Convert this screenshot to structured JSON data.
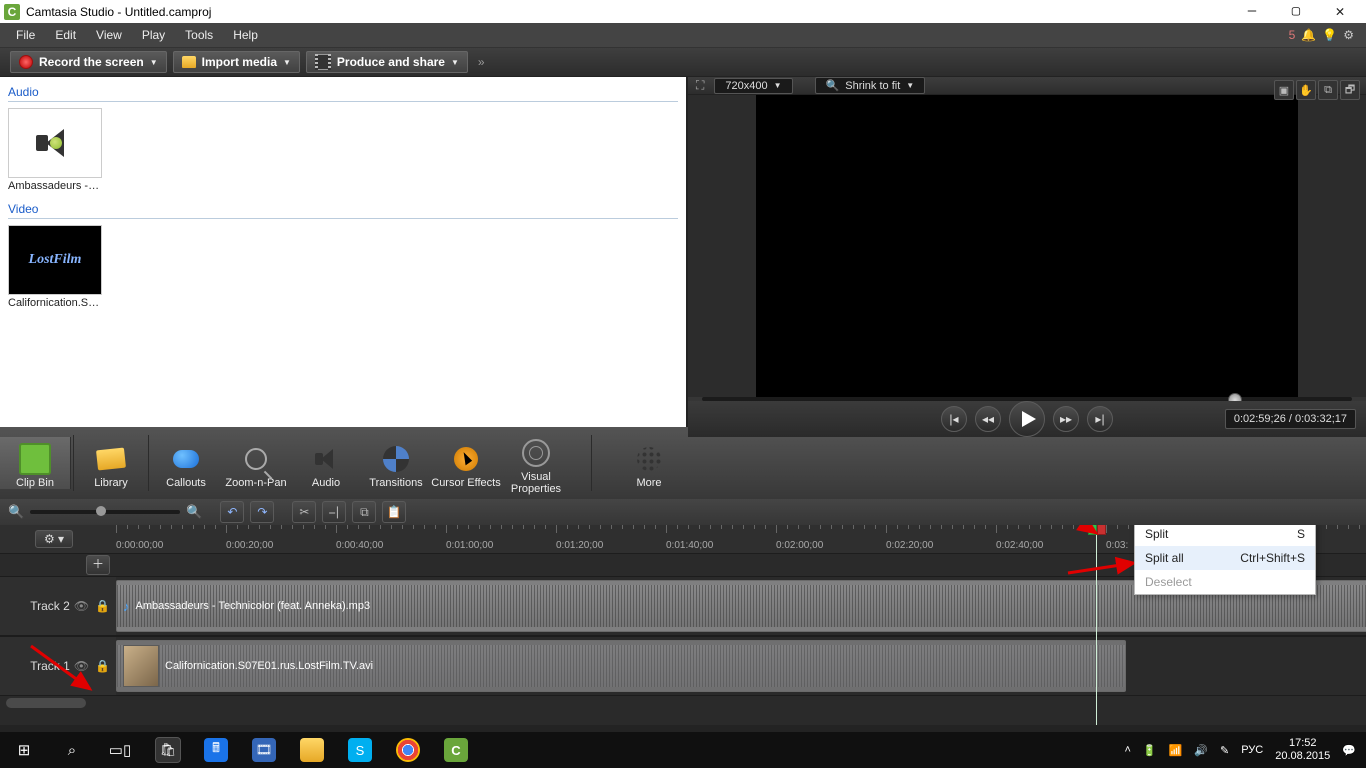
{
  "window": {
    "title": "Camtasia Studio - Untitled.camproj",
    "app": "C"
  },
  "menu": {
    "items": [
      "File",
      "Edit",
      "View",
      "Play",
      "Tools",
      "Help"
    ],
    "alert_count": "5"
  },
  "toolbar": {
    "record": "Record the screen",
    "import": "Import media",
    "produce": "Produce and share"
  },
  "clipbin": {
    "audio_label": "Audio",
    "audio": {
      "name": "Ambassadeurs - Technicolor (fe..."
    },
    "video_label": "Video",
    "video": {
      "name": "Californication.S0...",
      "thumb_text": "LostFilm"
    }
  },
  "preview": {
    "dim": "720x400",
    "shrink": "Shrink to fit",
    "time": "0:02:59;26 / 0:03:32;17"
  },
  "tabs": {
    "items": [
      "Clip Bin",
      "Library",
      "Callouts",
      "Zoom-n-Pan",
      "Audio",
      "Transitions",
      "Cursor Effects",
      "Visual Properties",
      "More"
    ]
  },
  "timeline": {
    "ticks": [
      "0:00:00;00",
      "0:00:20;00",
      "0:00:40;00",
      "0:01:00;00",
      "0:01:20;00",
      "0:01:40;00",
      "0:02:00;00",
      "0:02:20;00",
      "0:02:40;00",
      "0:03:"
    ],
    "track2": {
      "name": "Track 2",
      "clip": "Ambassadeurs - Technicolor (feat. Anneka).mp3"
    },
    "track1": {
      "name": "Track 1",
      "clip": "Californication.S07E01.rus.LostFilm.TV.avi"
    }
  },
  "context": {
    "split": {
      "label": "Split",
      "key": "S"
    },
    "splitall": {
      "label": "Split all",
      "key": "Ctrl+Shift+S"
    },
    "deselect": {
      "label": "Deselect"
    }
  },
  "taskbar": {
    "lang": "РУС",
    "time": "17:52",
    "date": "20.08.2015"
  }
}
